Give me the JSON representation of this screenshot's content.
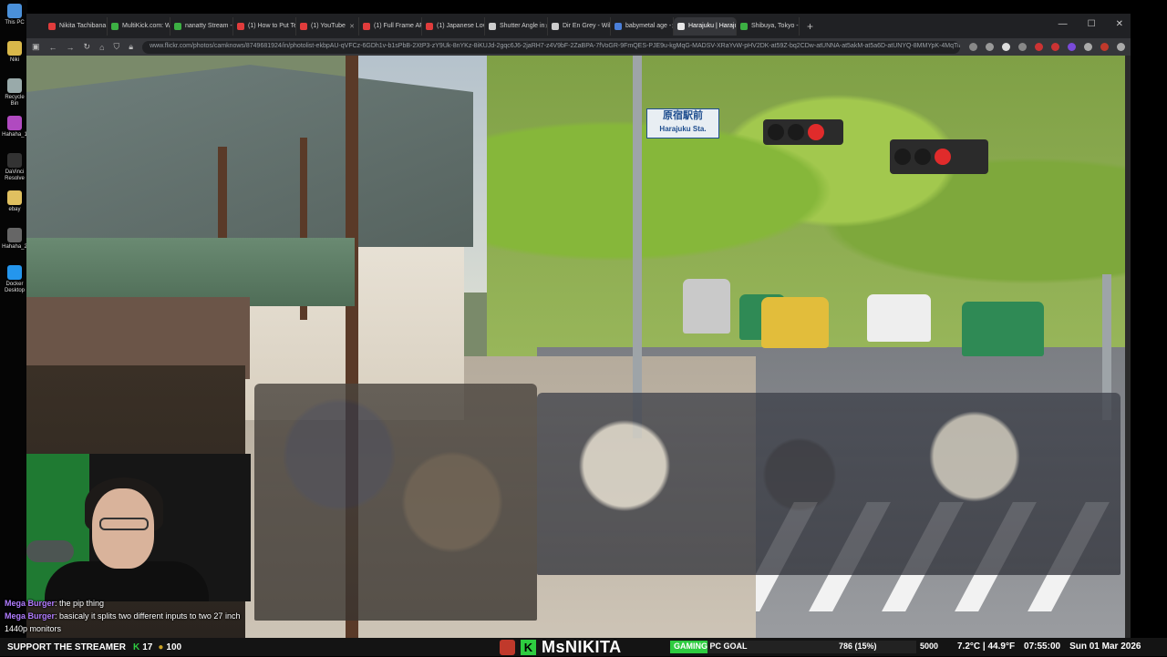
{
  "desktop": {
    "icons": [
      {
        "label": "This PC",
        "color": "#4a90d9"
      },
      {
        "label": "Niki",
        "color": "#d9b84a"
      },
      {
        "label": "Recycle Bin",
        "color": "#9aa"
      },
      {
        "label": "Hahaha_1",
        "color": "#b04ac0"
      },
      {
        "label": "DaVinci Resolve",
        "color": "#333"
      },
      {
        "label": "ebay",
        "color": "#e0c060"
      },
      {
        "label": "Hahaha_2",
        "color": "#666"
      },
      {
        "label": "Docker Desktop",
        "color": "#2496ed"
      }
    ]
  },
  "browser": {
    "tabs": [
      {
        "label": "Nikita Tachibana |",
        "icon_color": "#e03c3c",
        "active": false
      },
      {
        "label": "MultiKick.com: W",
        "icon_color": "#3cb043",
        "active": false
      },
      {
        "label": "nanatty Stream -",
        "icon_color": "#3cb043",
        "active": false
      },
      {
        "label": "(1) How to Put Te",
        "icon_color": "#e03c3c",
        "active": false
      },
      {
        "label": "(1) YouTube",
        "icon_color": "#e03c3c",
        "active": false
      },
      {
        "label": "(1) Full Frame AF",
        "icon_color": "#e03c3c",
        "active": false
      },
      {
        "label": "(1) Japanese Love",
        "icon_color": "#e03c3c",
        "active": false
      },
      {
        "label": "Shutter Angle in",
        "icon_color": "#cccccc",
        "active": false
      },
      {
        "label": "Dir En Grey - Wiki",
        "icon_color": "#cccccc",
        "active": false
      },
      {
        "label": "babymetal age -",
        "icon_color": "#4a7fd9",
        "active": false
      },
      {
        "label": "Harajuku | Haraju",
        "icon_color": "#e8e8e8",
        "active": true
      },
      {
        "label": "Shibuya, Tokyo -",
        "icon_color": "#3cb043",
        "active": false
      }
    ],
    "new_tab": "+",
    "url": "www.flickr.com/photos/camknows/8749681924/in/photolist-ekbpAU-qVFCz-6GDh1v-b1sPbB-2XtP3-zY9Uk-8nYKz-8iKUJd-2gqc6J6-2jaRH7-z4V9bF-2ZaBPA-7fVoGR-9FmQES-PJE9u-kgMqG-MADSV-XRaYvW-pHV2DK-at59Z-bq2CDw-atUNNA-at5akM-at5a6D-atUNYQ-8MMYpK-4MqTib",
    "window_controls": [
      "—",
      "☐",
      "✕"
    ]
  },
  "photo": {
    "sign_station": "原宿駅前",
    "sign_station_sub": "Harajuku Sta."
  },
  "chat": [
    {
      "name": "Mega Burger",
      "text": ": the pip thing"
    },
    {
      "name": "Mega Burger",
      "text": ": basicaly it splits two different inputs to two 27 inch"
    },
    {
      "name": "",
      "text": "1440p monitors"
    }
  ],
  "bottom": {
    "support_label": "SUPPORT THE STREAMER",
    "kicks": "17",
    "subs": "100",
    "brand_title": "MsNIKITA",
    "goal_label": "GAMING PC GOAL",
    "goal_progress": 0.15,
    "goal_amount": "786 (15%)",
    "goal_target": "5000",
    "temp": "7.2°C | 44.9°F",
    "time": "07:55:00",
    "date": "Sun 01 Mar 2026"
  }
}
